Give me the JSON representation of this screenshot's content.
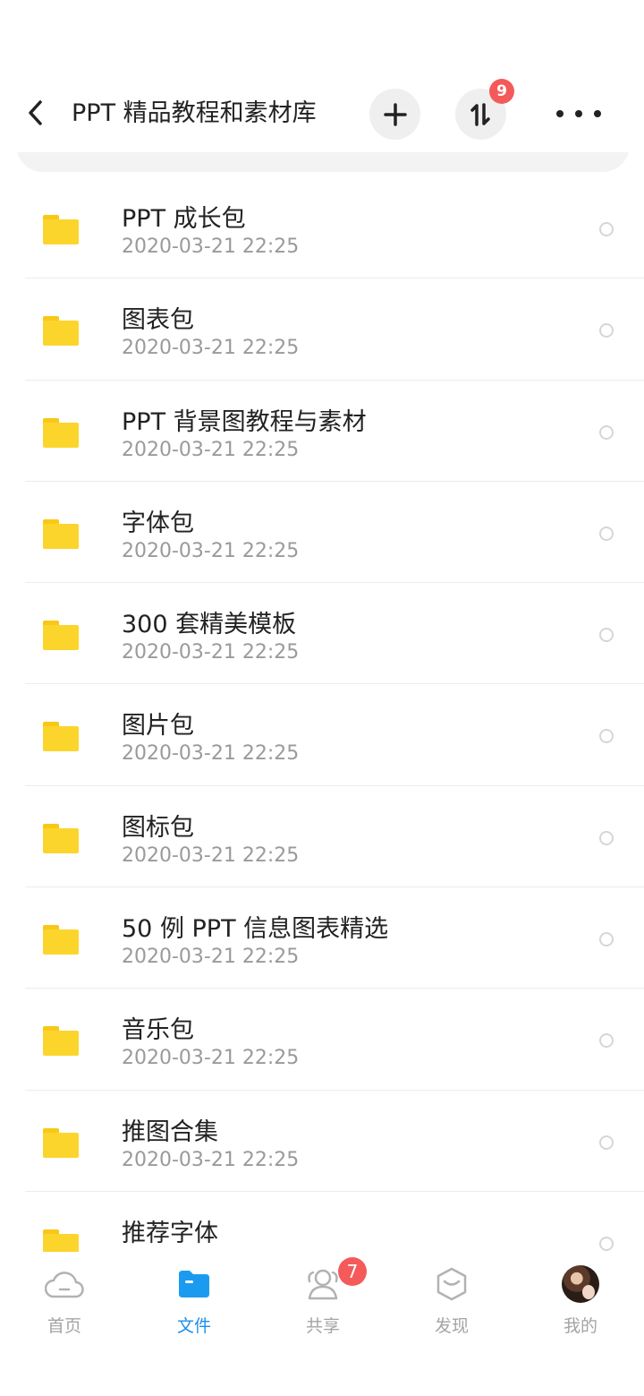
{
  "header": {
    "title": "PPT 精品教程和素材库",
    "sort_badge": "9"
  },
  "files": [
    {
      "name": "PPT 成长包",
      "date": "2020-03-21 22:25"
    },
    {
      "name": "图表包",
      "date": "2020-03-21 22:25"
    },
    {
      "name": "PPT 背景图教程与素材",
      "date": "2020-03-21 22:25"
    },
    {
      "name": "字体包",
      "date": "2020-03-21 22:25"
    },
    {
      "name": "300 套精美模板",
      "date": "2020-03-21 22:25"
    },
    {
      "name": "图片包",
      "date": "2020-03-21 22:25"
    },
    {
      "name": "图标包",
      "date": "2020-03-21 22:25"
    },
    {
      "name": "50 例 PPT 信息图表精选",
      "date": "2020-03-21 22:25"
    },
    {
      "name": "音乐包",
      "date": "2020-03-21 22:25"
    },
    {
      "name": "推图合集",
      "date": "2020-03-21 22:25"
    },
    {
      "name": "推荐字体",
      "date": ""
    }
  ],
  "tabbar": {
    "home": "首页",
    "files": "文件",
    "share": "共享",
    "share_badge": "7",
    "discover": "发现",
    "mine": "我的"
  },
  "colors": {
    "accent": "#1b8fea",
    "folder": "#fcd52c",
    "badge": "#f55a5a"
  }
}
